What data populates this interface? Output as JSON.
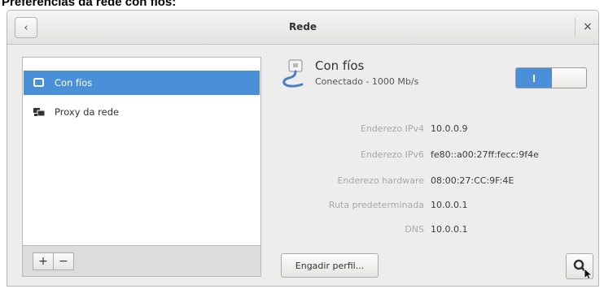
{
  "caption": "Preferencias da rede con fíos:",
  "window": {
    "title": "Rede"
  },
  "titlebar": {
    "back_icon": "‹",
    "close_icon": "×"
  },
  "sidebar": {
    "items": [
      {
        "label": "Con fíos",
        "icon": "wired-icon",
        "selected": true
      },
      {
        "label": "Proxy da rede",
        "icon": "proxy-icon",
        "selected": false
      }
    ],
    "toolbar": {
      "add": "+",
      "remove": "−"
    }
  },
  "connection": {
    "name": "Con fíos",
    "status": "Conectado - 1000 Mb/s",
    "enabled": true
  },
  "details": [
    {
      "label": "Enderezo IPv4",
      "value": "10.0.0.9"
    },
    {
      "label": "Enderezo IPv6",
      "value": "fe80::a00:27ff:fecc:9f4e"
    },
    {
      "label": "Enderezo hardware",
      "value": "08:00:27:CC:9F:4E"
    },
    {
      "label": "Ruta predeterminada",
      "value": "10.0.0.1"
    },
    {
      "label": "DNS",
      "value": "10.0.0.1"
    }
  ],
  "buttons": {
    "add_profile": "Engadir perfil..."
  },
  "colors": {
    "accent": "#4a90d9"
  }
}
